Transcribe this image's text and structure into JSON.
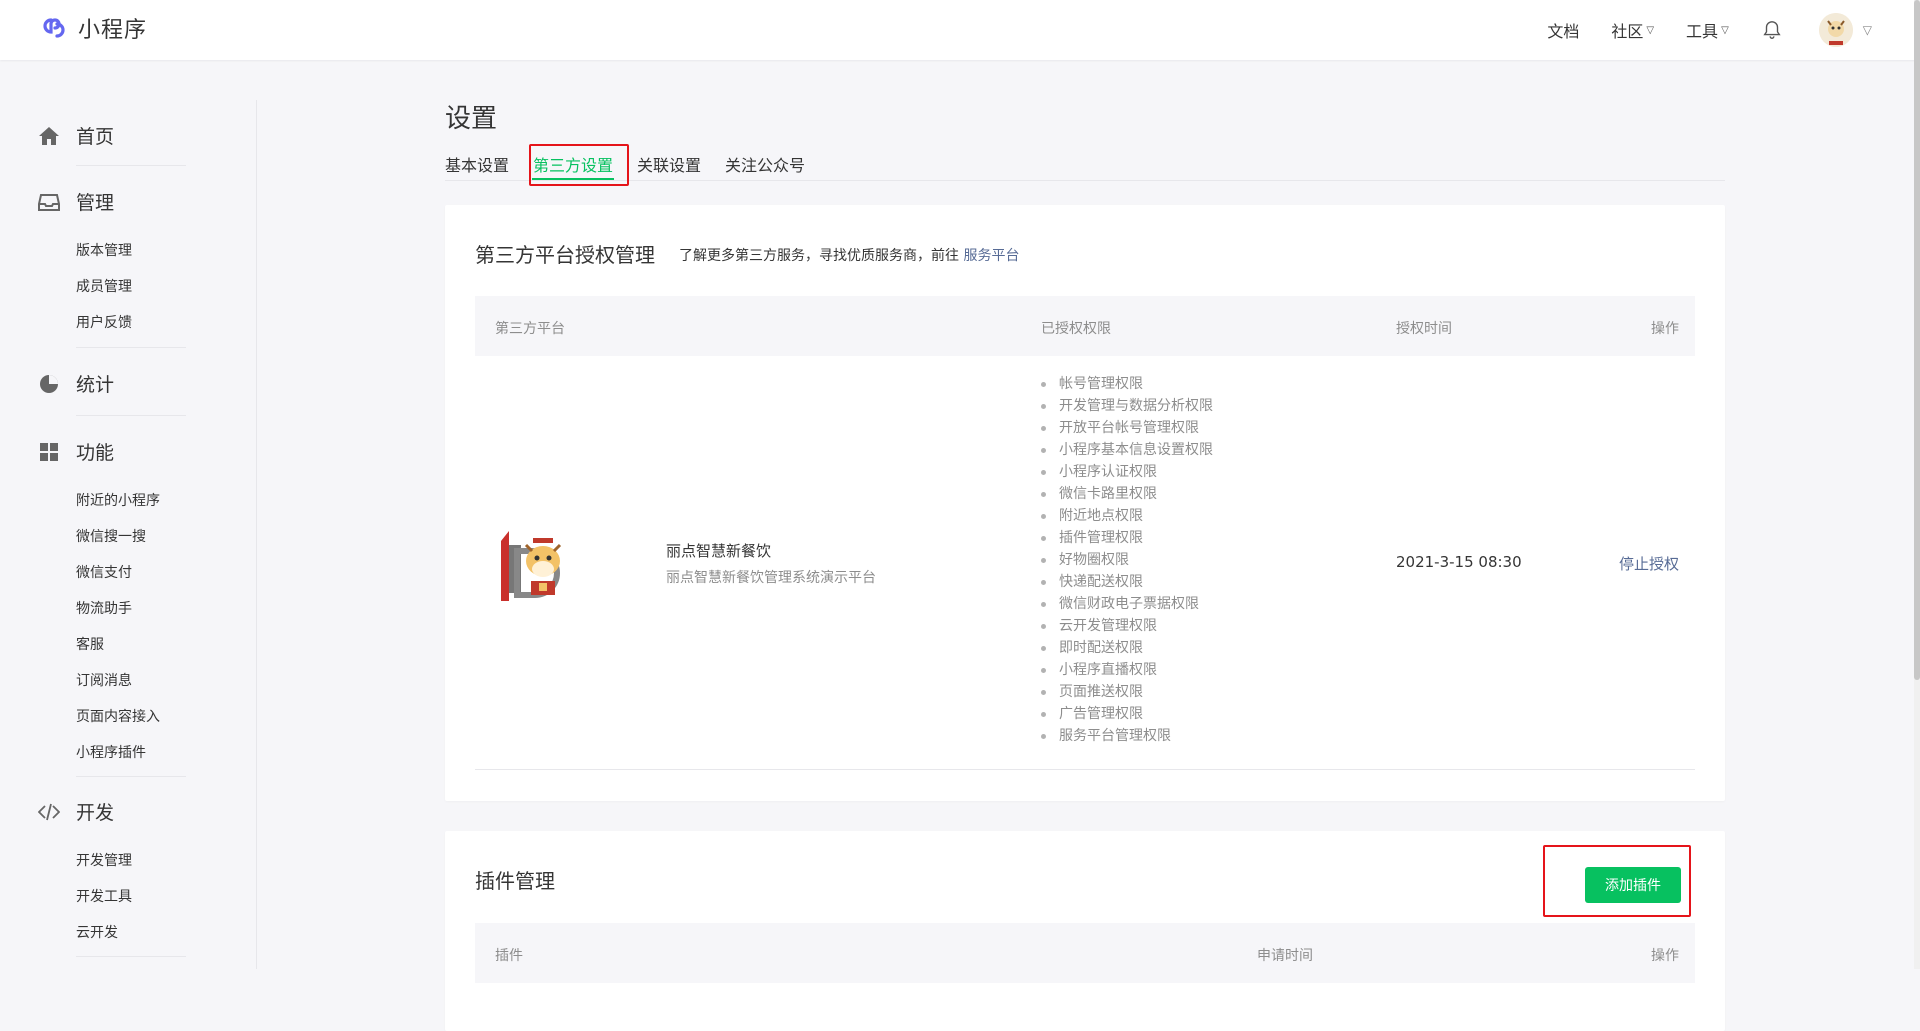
{
  "header": {
    "logo_text": "小程序",
    "nav": [
      {
        "label": "文档"
      },
      {
        "label": "社区"
      },
      {
        "label": "工具"
      }
    ]
  },
  "sidebar": {
    "groups": [
      {
        "label": "首页",
        "icon": "home-icon",
        "items": []
      },
      {
        "label": "管理",
        "icon": "inbox-icon",
        "items": [
          "版本管理",
          "成员管理",
          "用户反馈"
        ]
      },
      {
        "label": "统计",
        "icon": "pie-chart-icon",
        "items": []
      },
      {
        "label": "功能",
        "icon": "grid-icon",
        "items": [
          "附近的小程序",
          "微信搜一搜",
          "微信支付",
          "物流助手",
          "客服",
          "订阅消息",
          "页面内容接入",
          "小程序插件"
        ]
      },
      {
        "label": "开发",
        "icon": "code-icon",
        "items": [
          "开发管理",
          "开发工具",
          "云开发"
        ]
      }
    ]
  },
  "page": {
    "title": "设置",
    "tabs": [
      "基本设置",
      "第三方设置",
      "关联设置",
      "关注公众号"
    ],
    "active_tab": "第三方设置"
  },
  "auth_card": {
    "title": "第三方平台授权管理",
    "desc_prefix": "了解更多第三方服务，寻找优质服务商，前往",
    "desc_link": "服务平台",
    "columns": [
      "第三方平台",
      "已授权权限",
      "授权时间",
      "操作"
    ],
    "row": {
      "name": "丽点智慧新餐饮",
      "desc": "丽点智慧新餐饮管理系统演示平台",
      "permissions": [
        "帐号管理权限",
        "开发管理与数据分析权限",
        "开放平台帐号管理权限",
        "小程序基本信息设置权限",
        "小程序认证权限",
        "微信卡路里权限",
        "附近地点权限",
        "插件管理权限",
        "好物圈权限",
        "快递配送权限",
        "微信财政电子票据权限",
        "云开发管理权限",
        "即时配送权限",
        "小程序直播权限",
        "页面推送权限",
        "广告管理权限",
        "服务平台管理权限"
      ],
      "time": "2021-3-15 08:30",
      "action": "停止授权"
    }
  },
  "plugin_card": {
    "title": "插件管理",
    "add_button": "添加插件",
    "columns": [
      "插件",
      "申请时间",
      "操作"
    ]
  },
  "colors": {
    "accent": "#07c160",
    "link": "#576b95",
    "highlight": "#e5141a"
  }
}
